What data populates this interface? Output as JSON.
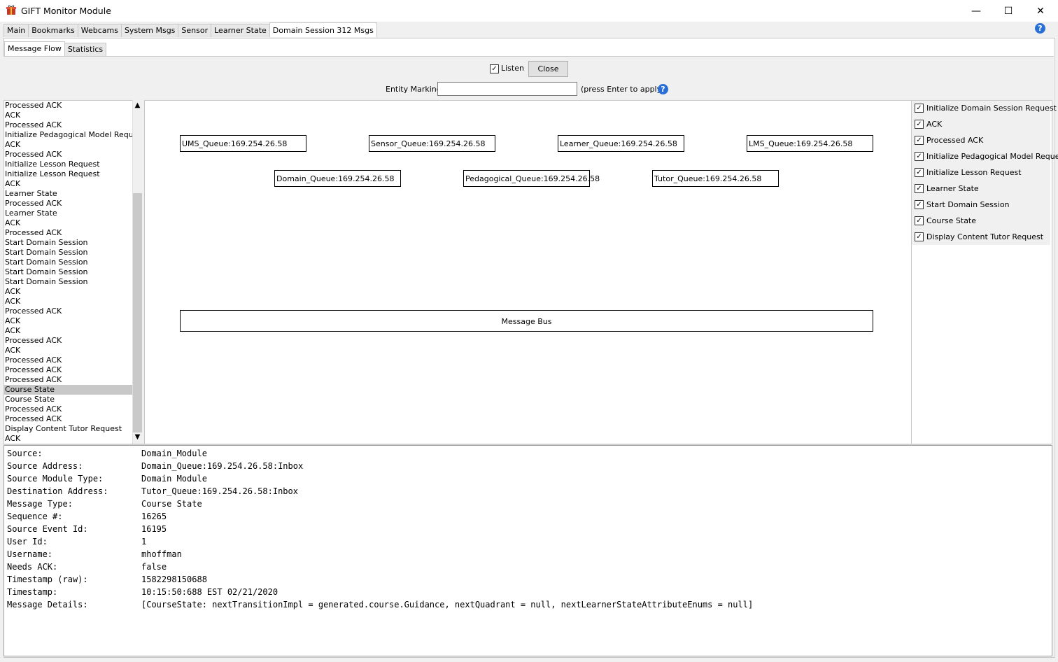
{
  "window": {
    "title": "GIFT Monitor Module",
    "minimize": "—",
    "maximize": "☐",
    "close": "✕"
  },
  "main_tabs": [
    "Main",
    "Bookmarks",
    "Webcams",
    "System Msgs",
    "Sensor",
    "Learner State",
    "Domain Session 312 Msgs"
  ],
  "help_icon": "?",
  "sub_tabs": [
    "Message Flow",
    "Statistics"
  ],
  "controls": {
    "listen_label": "Listen",
    "listen_checked": true,
    "close_button": "Close",
    "entity_marking_label": "Entity Marking",
    "entity_marking_value": "",
    "press_enter_hint": "(press Enter to apply)"
  },
  "message_list": {
    "selected_index": 29,
    "items": [
      "Processed ACK",
      "ACK",
      "Processed ACK",
      "Initialize Pedagogical Model Request",
      "ACK",
      "Processed ACK",
      "Initialize Lesson Request",
      "Initialize Lesson Request",
      "ACK",
      "Learner State",
      "Processed ACK",
      "Learner State",
      "ACK",
      "Processed ACK",
      "Start Domain Session",
      "Start Domain Session",
      "Start Domain Session",
      "Start Domain Session",
      "Start Domain Session",
      "ACK",
      "ACK",
      "Processed ACK",
      "ACK",
      "ACK",
      "Processed ACK",
      "ACK",
      "Processed ACK",
      "Processed ACK",
      "Processed ACK",
      "Course State",
      "Course State",
      "Processed ACK",
      "Processed ACK",
      "Display Content Tutor Request",
      "ACK"
    ]
  },
  "diagram": {
    "queues": [
      "UMS_Queue:169.254.26.58",
      "Sensor_Queue:169.254.26.58",
      "Learner_Queue:169.254.26.58",
      "LMS_Queue:169.254.26.58",
      "Domain_Queue:169.254.26.58",
      "Pedagogical_Queue:169.254.26.58",
      "Tutor_Queue:169.254.26.58"
    ],
    "message_bus": "Message Bus"
  },
  "filters": [
    {
      "label": "Initialize Domain Session Request",
      "checked": true
    },
    {
      "label": "ACK",
      "checked": true
    },
    {
      "label": "Processed ACK",
      "checked": true
    },
    {
      "label": "Initialize Pedagogical Model Request",
      "checked": true
    },
    {
      "label": "Initialize Lesson Request",
      "checked": true
    },
    {
      "label": "Learner State",
      "checked": true
    },
    {
      "label": "Start Domain Session",
      "checked": true
    },
    {
      "label": "Course State",
      "checked": true
    },
    {
      "label": "Display Content Tutor Request",
      "checked": true
    }
  ],
  "details": [
    {
      "label": "Source:",
      "value": "Domain_Module"
    },
    {
      "label": "Source Address:",
      "value": "Domain_Queue:169.254.26.58:Inbox"
    },
    {
      "label": "Source Module Type:",
      "value": "Domain Module"
    },
    {
      "label": "Destination Address:",
      "value": "Tutor_Queue:169.254.26.58:Inbox"
    },
    {
      "label": "Message Type:",
      "value": "Course State"
    },
    {
      "label": "Sequence #:",
      "value": "16265"
    },
    {
      "label": "Source Event Id:",
      "value": "16195"
    },
    {
      "label": "User Id:",
      "value": "1"
    },
    {
      "label": "Username:",
      "value": "mhoffman"
    },
    {
      "label": "Needs ACK:",
      "value": "false"
    },
    {
      "label": "Timestamp (raw):",
      "value": "1582298150688"
    },
    {
      "label": "Timestamp:",
      "value": "10:15:50:688 EST 02/21/2020"
    },
    {
      "label": "Message Details:",
      "value": "[CourseState: nextTransitionImpl = generated.course.Guidance, nextQuadrant = null, nextLearnerStateAttributeEnums = null]"
    }
  ]
}
